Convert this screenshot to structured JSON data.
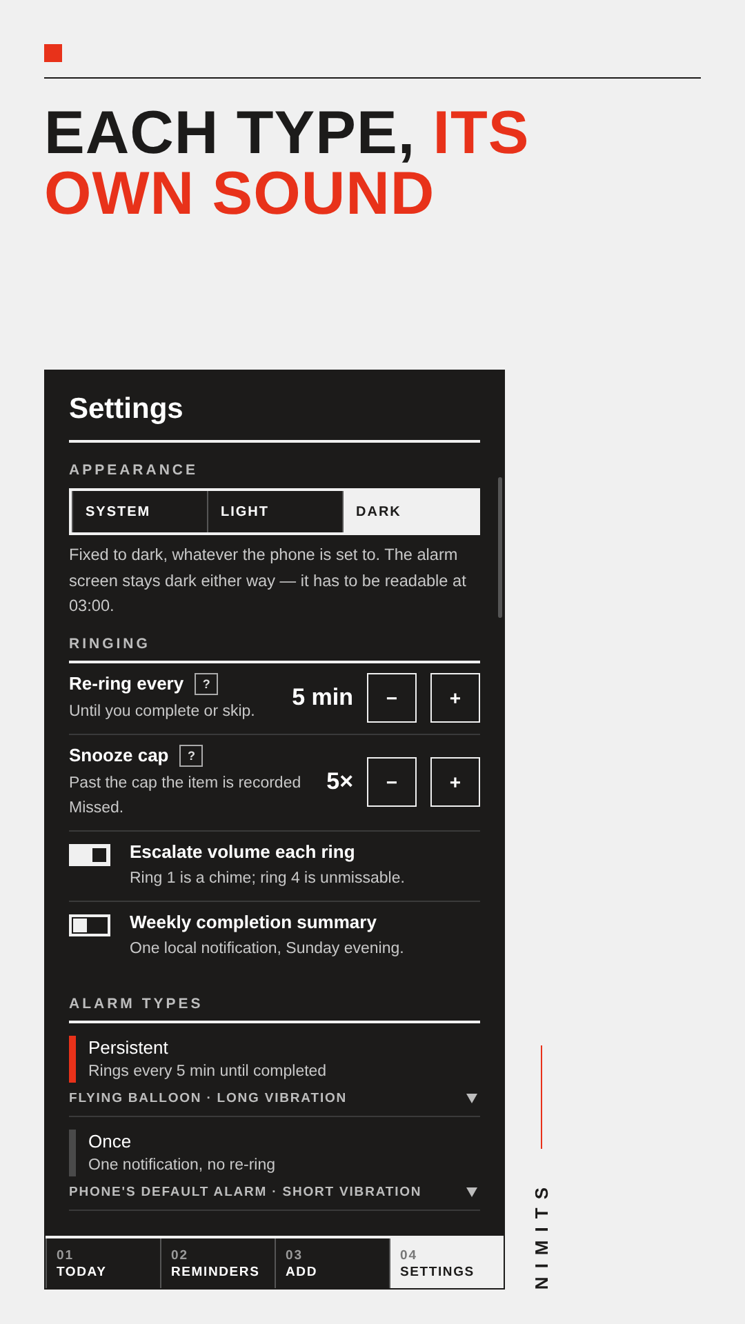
{
  "headline": [
    {
      "text": "EACH TYPE,",
      "accent": false
    },
    {
      "text": "ITS OWN SOUND",
      "accent": true
    }
  ],
  "screen": {
    "title": "Settings",
    "appearance": {
      "label": "APPEARANCE",
      "options": [
        {
          "label": "SYSTEM",
          "selected": false
        },
        {
          "label": "LIGHT",
          "selected": false
        },
        {
          "label": "DARK",
          "selected": true
        }
      ],
      "description": "Fixed to dark, whatever the phone is set to. The alarm screen stays dark either way — it has to be readable at 03:00."
    },
    "ringing": {
      "label": "RINGING",
      "rows": [
        {
          "kind": "stepper",
          "title": "Re-ring every",
          "help": "?",
          "subtitle": "Until you complete or skip.",
          "value": "5 min",
          "minus": "−",
          "plus": "+"
        },
        {
          "kind": "stepper",
          "title": "Snooze cap",
          "help": "?",
          "subtitle": "Past the cap the item is recorded Missed.",
          "value": "5×",
          "minus": "−",
          "plus": "+"
        },
        {
          "kind": "toggle",
          "title": "Escalate volume each ring",
          "subtitle": "Ring 1 is a chime; ring 4 is unmissable.",
          "on": true
        },
        {
          "kind": "toggle",
          "title": "Weekly completion summary",
          "subtitle": "One local notification, Sunday evening.",
          "on": false
        }
      ]
    },
    "alarm_types": {
      "label": "ALARM TYPES",
      "items": [
        {
          "name": "Persistent",
          "description": "Rings every 5 min until completed",
          "sound": "FLYING BALLOON · LONG VIBRATION",
          "color": "#e8321a"
        },
        {
          "name": "Once",
          "description": "One notification, no re-ring",
          "sound": "PHONE'S DEFAULT ALARM · SHORT VIBRATION",
          "color": "#4a4a4a"
        }
      ]
    },
    "nav": [
      {
        "number": "01",
        "label": "TODAY",
        "selected": false
      },
      {
        "number": "02",
        "label": "REMINDERS",
        "selected": false
      },
      {
        "number": "03",
        "label": "ADD",
        "selected": false
      },
      {
        "number": "04",
        "label": "SETTINGS",
        "selected": true
      }
    ]
  },
  "side_label": "NIMITS"
}
